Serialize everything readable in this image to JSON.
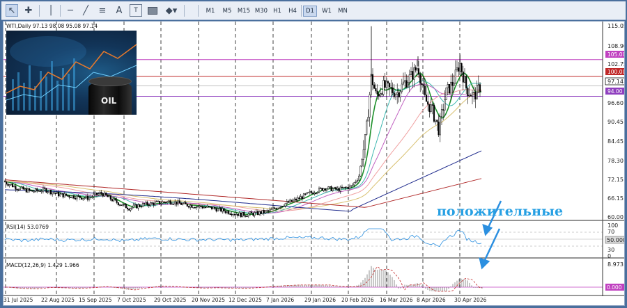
{
  "toolbar": {
    "tools": [
      "cursor-icon",
      "crosshair-icon",
      "vertical-line-icon",
      "horizontal-line-icon",
      "trend-line-icon",
      "fibonacci-icon",
      "text-icon",
      "text-label-icon",
      "rectangle-icon",
      "shapes-icon"
    ],
    "timeframes": [
      "M1",
      "M5",
      "M15",
      "M30",
      "H1",
      "H4",
      "D1",
      "W1",
      "MN"
    ],
    "selected_timeframe": "D1"
  },
  "chart": {
    "header": "WTI,Daily  97.13 98.08 95.08 97.14",
    "thumbnail_text": "OIL",
    "annotation": "положительные",
    "price_axis": [
      "115.05",
      "108.90",
      "102.75",
      "96.60",
      "90.45",
      "84.45",
      "78.30",
      "72.15",
      "66.15",
      "60.00"
    ],
    "level_tags": [
      {
        "label": "105.00",
        "color": "#c040c0"
      },
      {
        "label": "100.00",
        "color": "#c02828"
      },
      {
        "label": "97.14",
        "color": "#ffffff"
      },
      {
        "label": "94.00",
        "color": "#8f3fbf"
      }
    ],
    "date_axis": [
      "31 Jul 2025",
      "22 Aug 2025",
      "15 Sep 2025",
      "7 Oct 2025",
      "29 Oct 2025",
      "20 Nov 2025",
      "12 Dec 2025",
      "7 Jan 2026",
      "29 Jan 2026",
      "20 Feb 2026",
      "16 Mar 2026",
      "8 Apr 2026",
      "30 Apr 2026"
    ]
  },
  "rsi": {
    "header": "RSI(14) 53.0769",
    "axis": [
      "100",
      "70",
      "30",
      "0"
    ],
    "level_tag": "50.000"
  },
  "macd": {
    "header": "MACD(12,26,9) 1.429 1.966",
    "axis_top": "8.973",
    "level_tag": "0.000"
  },
  "chart_data": {
    "type": "candlestick",
    "symbol": "WTI",
    "timeframe": "Daily",
    "ylim": [
      57,
      116
    ],
    "horizontal_levels": [
      105.0,
      100.0,
      94.0
    ],
    "last_price": 97.14,
    "close_path": [
      [
        0,
        68.5
      ],
      [
        20,
        66.5
      ],
      [
        40,
        65.5
      ],
      [
        60,
        66.0
      ],
      [
        80,
        64.5
      ],
      [
        100,
        64.0
      ],
      [
        120,
        63.5
      ],
      [
        140,
        65.0
      ],
      [
        160,
        62.5
      ],
      [
        180,
        60.5
      ],
      [
        200,
        61.5
      ],
      [
        220,
        62.0
      ],
      [
        240,
        62.5
      ],
      [
        260,
        61.5
      ],
      [
        280,
        61.0
      ],
      [
        300,
        60.5
      ],
      [
        320,
        59.5
      ],
      [
        340,
        58.5
      ],
      [
        360,
        58.8
      ],
      [
        380,
        59.5
      ],
      [
        400,
        61.5
      ],
      [
        420,
        63.0
      ],
      [
        440,
        65.0
      ],
      [
        460,
        66.5
      ],
      [
        480,
        66.0
      ],
      [
        500,
        67.0
      ],
      [
        510,
        70.0
      ],
      [
        520,
        82.0
      ],
      [
        528,
        100.0
      ],
      [
        535,
        94.0
      ],
      [
        545,
        97.0
      ],
      [
        555,
        96.0
      ],
      [
        565,
        95.0
      ],
      [
        575,
        98.0
      ],
      [
        585,
        100.0
      ],
      [
        595,
        103.0
      ],
      [
        605,
        93.0
      ],
      [
        615,
        90.0
      ],
      [
        625,
        84.0
      ],
      [
        635,
        95.0
      ],
      [
        645,
        98.0
      ],
      [
        655,
        104.0
      ],
      [
        665,
        96.0
      ],
      [
        675,
        94.0
      ],
      [
        685,
        97.1
      ]
    ],
    "volume_hint": ""
  }
}
